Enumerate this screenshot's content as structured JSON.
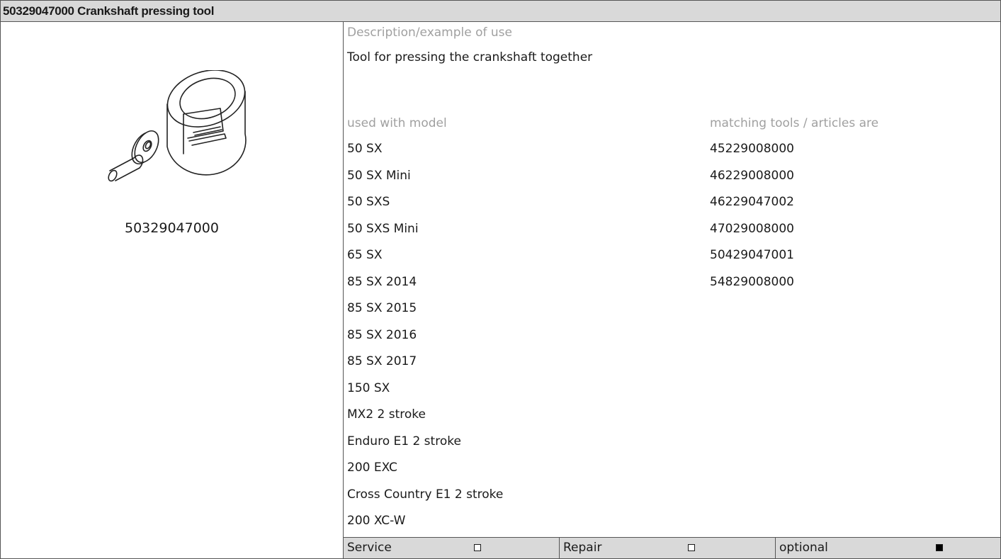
{
  "header": {
    "title": "50329047000 Crankshaft pressing tool"
  },
  "tool": {
    "image_icon": "crankshaft-pressing-tool-icon",
    "part_number": "50329047000"
  },
  "description": {
    "label": "Description/example of use",
    "text": "Tool for pressing the crankshaft together"
  },
  "models": {
    "header": "used with model",
    "items": [
      "50 SX",
      "50 SX Mini",
      "50 SXS",
      "50 SXS Mini",
      "65 SX",
      "85 SX 2014",
      "85 SX 2015",
      "85 SX 2016",
      "85 SX 2017",
      "150 SX",
      "MX2 2 stroke",
      "Enduro E1 2 stroke",
      "200 EXC",
      "Cross Country E1 2 stroke",
      "200 XC-W"
    ]
  },
  "matching": {
    "header": "matching tools / articles are",
    "items": [
      "45229008000",
      "46229008000",
      "46229047002",
      "47029008000",
      "50429047001",
      "54829008000"
    ]
  },
  "footer": {
    "service": {
      "label": "Service",
      "checked": false
    },
    "repair": {
      "label": "Repair",
      "checked": false
    },
    "optional": {
      "label": "optional",
      "checked": true
    }
  },
  "colors": {
    "header_bg": "#d9d9d9",
    "secondary_label": "#a0a0a0",
    "border": "#555555"
  }
}
